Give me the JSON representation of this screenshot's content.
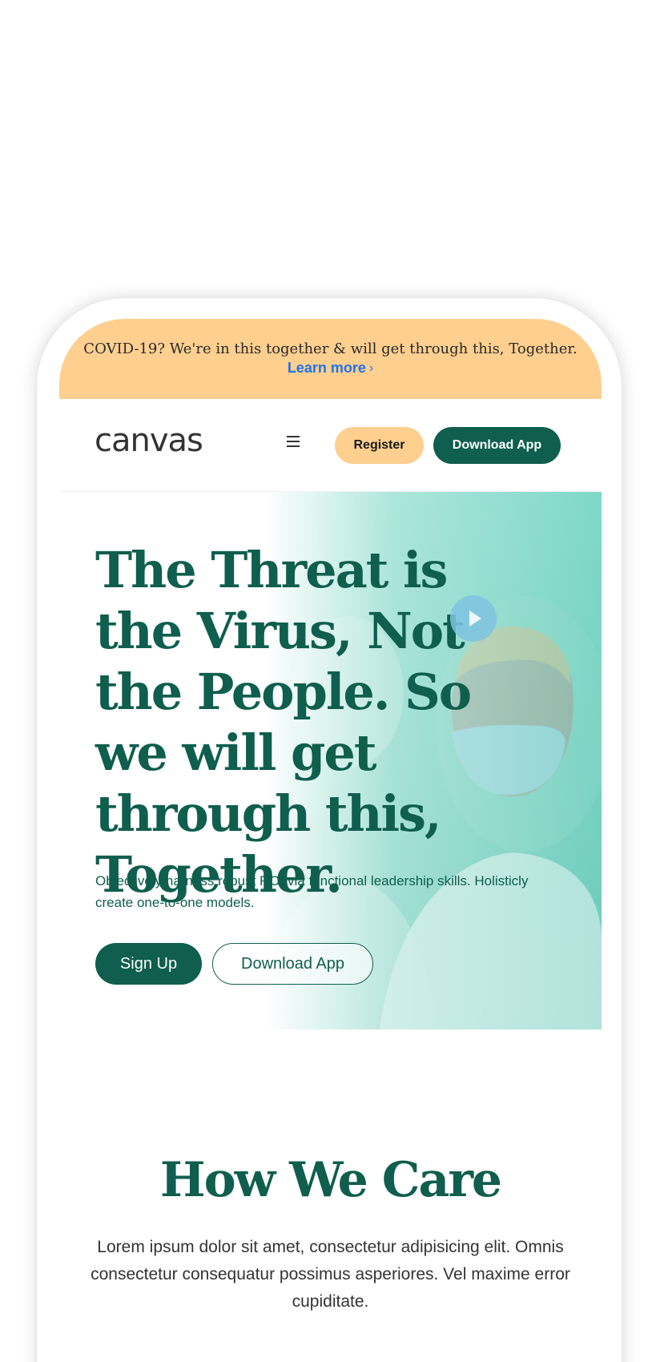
{
  "announcement": {
    "text": "COVID-19? We're in this together & will get through this, Together.",
    "link_label": "Learn more",
    "link_icon": "chevron-right-icon"
  },
  "header": {
    "logo": "canvas",
    "menu_icon": "hamburger-menu-icon",
    "register_label": "Register",
    "download_label": "Download App"
  },
  "hero": {
    "title": "The Threat is the Virus, Not the People. So we will get through this, Together.",
    "subtitle": "Objectively harness robust ROI via functional leadership skills. Holisticly create one-to-one models.",
    "signup_label": "Sign Up",
    "download_label": "Download App",
    "play_icon": "play-icon"
  },
  "care": {
    "title": "How We Care",
    "text": "Lorem ipsum dolor sit amet, consectetur adipisicing elit. Omnis consectetur consequatur possimus asperiores. Vel maxime error cupiditate."
  },
  "colors": {
    "primary_green": "#0f5e4e",
    "accent_peach": "#fecf8f",
    "link_blue": "#1e73e8",
    "hero_teal": "#6fcfbd"
  }
}
